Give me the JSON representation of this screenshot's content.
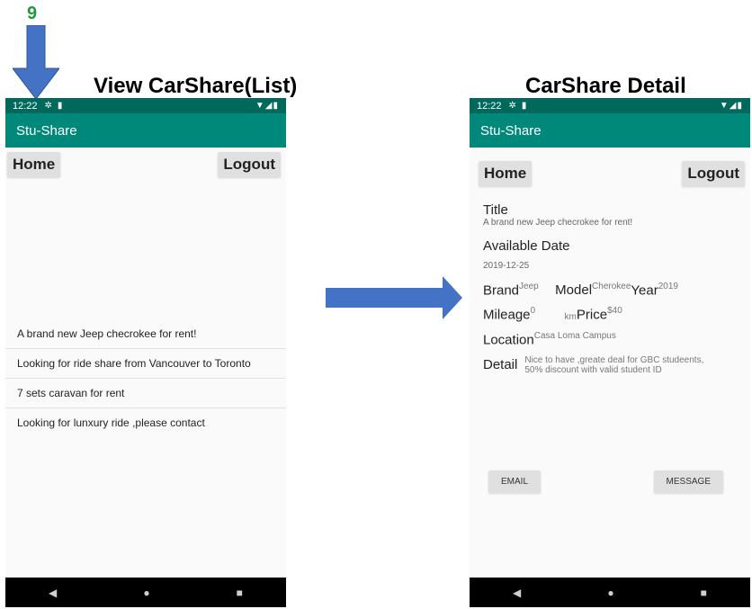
{
  "step_number": "9",
  "captions": {
    "left": "View CarShare(List)",
    "right": "CarShare Detail"
  },
  "colors": {
    "status_bar": "#00695c",
    "app_bar": "#00897b",
    "arrow": "#4472c4",
    "step_number": "#1e9c3c"
  },
  "statusbar": {
    "time": "12:22",
    "icons": [
      "settings-icon",
      "sd-card-icon"
    ],
    "right_icons": [
      "wifi-icon",
      "signal-icon",
      "battery-icon"
    ]
  },
  "list_screen": {
    "app_title": "Stu-Share",
    "home_label": "Home",
    "logout_label": "Logout",
    "items": [
      "A brand new Jeep checrokee for rent!",
      "Looking for ride share from Vancouver to Toronto",
      "7 sets caravan for rent",
      "Looking for lunxury ride ,please contact"
    ]
  },
  "detail_screen": {
    "app_title": "Stu-Share",
    "home_label": "Home",
    "logout_label": "Logout",
    "title_label": "Title",
    "title_value": "A brand new Jeep checrokee for rent!",
    "available_date_label": "Available Date",
    "available_date_value": "2019-12-25",
    "brand_label": "Brand",
    "brand_value": "Jeep",
    "model_label": "Model",
    "model_value": "Cherokee",
    "year_label": "Year",
    "year_value": "2019",
    "mileage_label": "Mileage",
    "mileage_value": "0",
    "mileage_unit": "km",
    "price_label": "Price",
    "price_value": "$40",
    "location_label": "Location",
    "location_value": "Casa Loma Campus",
    "detail_label": "Detail",
    "detail_value": "Nice to have ,greate deal for GBC studeents, 50% discount with valid student ID",
    "email_label": "EMAIL",
    "message_label": "MESSAGE"
  },
  "navbar": {
    "back": "◀",
    "home": "●",
    "recents": "■"
  }
}
